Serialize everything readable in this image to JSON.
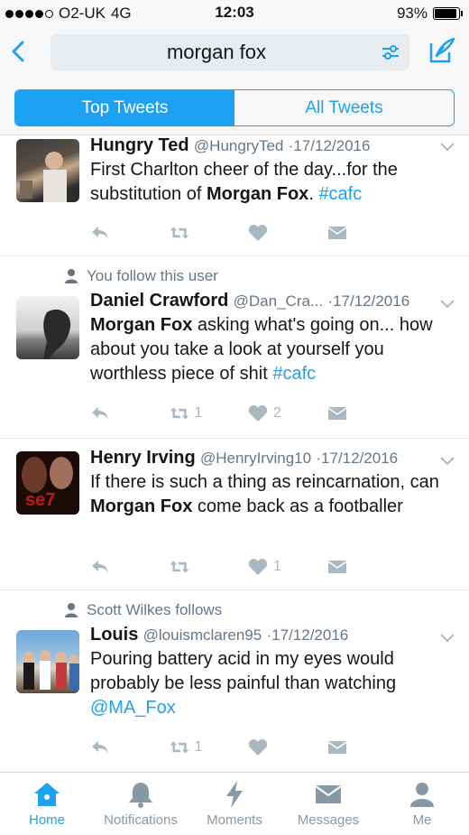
{
  "status": {
    "carrier": "O2-UK",
    "network": "4G",
    "time": "12:03",
    "battery": "93%",
    "battery_level": 0.93
  },
  "search": {
    "query": "morgan fox"
  },
  "tabs": {
    "top": "Top Tweets",
    "all": "All Tweets"
  },
  "tweets": [
    {
      "context": "",
      "name": "Hungry Ted",
      "handle": "@HungryTed",
      "date": "17/12/2016",
      "text_a": "First Charlton cheer of the day...for the substitution of ",
      "mention": "Morgan Fox",
      "text_b": ". ",
      "link": "#cafc",
      "retweets": "",
      "likes": ""
    },
    {
      "context": "You follow this user",
      "name": "Daniel Crawford",
      "handle": "@Dan_Cra...",
      "date": "17/12/2016",
      "mention": "Morgan Fox",
      "text_a": " asking what's going on... how about you take a look at yourself you worthless piece of shit ",
      "link": "#cafc",
      "retweets": "1",
      "likes": "2"
    },
    {
      "context": "",
      "name": "Henry Irving",
      "handle": "@HenryIrving10",
      "date": "17/12/2016",
      "text_a": "If there is such a thing as reincarnation, can ",
      "mention": "Morgan Fox",
      "text_b": " come back as a footballer",
      "retweets": "",
      "likes": "1"
    },
    {
      "context": "Scott Wilkes follows",
      "name": "Louis",
      "handle": "@louismclaren95",
      "date": "17/12/2016",
      "text_a": "Pouring battery acid in my eyes would probably be less painful than watching ",
      "link": "@MA_Fox",
      "retweets": "1",
      "likes": ""
    }
  ],
  "tabbar": {
    "home": "Home",
    "notifications": "Notifications",
    "moments": "Moments",
    "messages": "Messages",
    "me": "Me"
  },
  "colors": {
    "accent": "#1da1f2",
    "muted": "#657786",
    "icon": "#aab8c2"
  },
  "icons": [
    "back-arrow-icon",
    "filter-icon",
    "compose-icon",
    "reply-icon",
    "retweet-icon",
    "heart-icon",
    "dm-icon",
    "chevron-down-icon",
    "person-icon",
    "home-icon",
    "bell-icon",
    "lightning-icon",
    "envelope-icon",
    "user-icon"
  ]
}
